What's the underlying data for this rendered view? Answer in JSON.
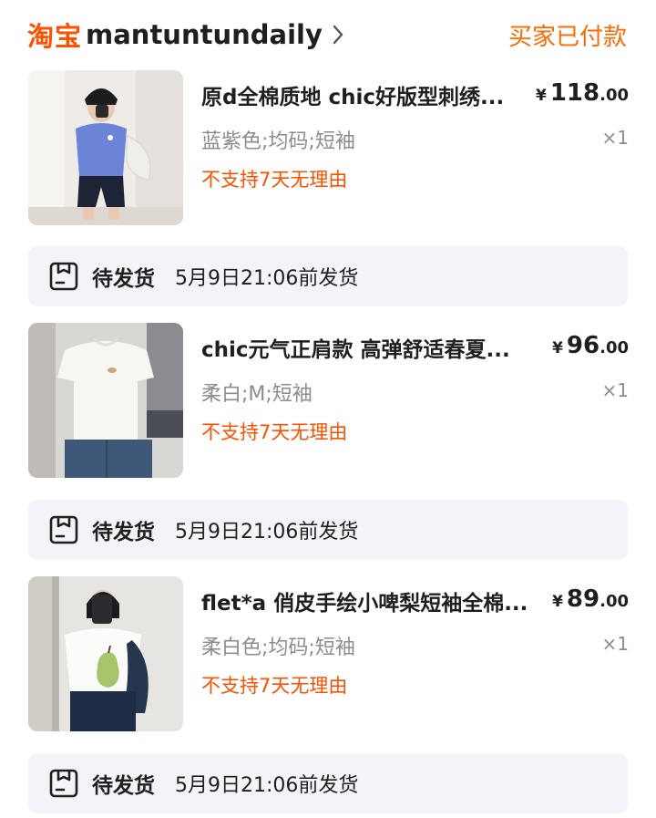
{
  "header": {
    "brand": "淘宝",
    "shop_name": "mantuntundaily",
    "order_status": "买家已付款",
    "accent": "#ff5000"
  },
  "items": [
    {
      "title": "原d全棉质地 chic好版型刺绣...",
      "price_symbol": "¥",
      "price_int": "118",
      "price_dec": ".00",
      "sku": "蓝紫色;均码;短袖",
      "quantity": "×1",
      "policy": "不支持7天无理由",
      "shipping": {
        "status": "待发货",
        "time": "5月9日21:06前发货"
      }
    },
    {
      "title": "chic元气正肩款 高弹舒适春夏...",
      "price_symbol": "¥",
      "price_int": "96",
      "price_dec": ".00",
      "sku": "柔白;M;短袖",
      "quantity": "×1",
      "policy": "不支持7天无理由",
      "shipping": {
        "status": "待发货",
        "time": "5月9日21:06前发货"
      }
    },
    {
      "title": "flet*a 俏皮手绘小啤梨短袖全棉...",
      "price_symbol": "¥",
      "price_int": "89",
      "price_dec": ".00",
      "sku": "柔白色;均码;短袖",
      "quantity": "×1",
      "policy": "不支持7天无理由",
      "shipping": {
        "status": "待发货",
        "time": "5月9日21:06前发货"
      }
    }
  ]
}
